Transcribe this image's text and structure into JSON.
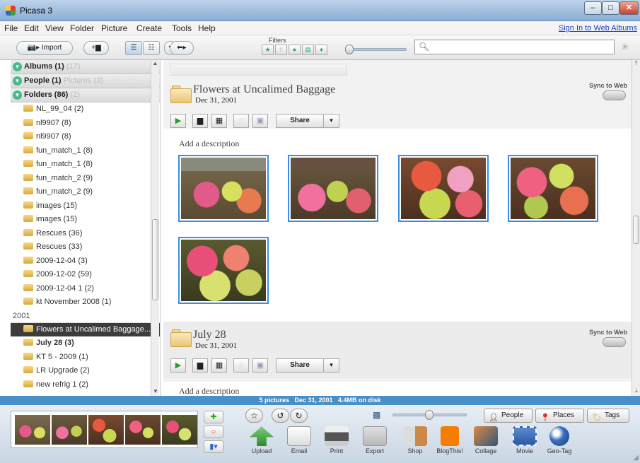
{
  "window": {
    "title": "Picasa 3"
  },
  "menu": [
    "File",
    "Edit",
    "View",
    "Folder",
    "Picture",
    "Create",
    "Tools",
    "Help"
  ],
  "signin": "Sign In to Web Albums",
  "toolbar": {
    "import_label": "Import",
    "filters_label": "Filters"
  },
  "search": {
    "value": "",
    "placeholder": ""
  },
  "leftpanel": {
    "albums": {
      "label": "Albums (1)",
      "ghost": "(17)"
    },
    "people": {
      "label": "People (1)",
      "ghost": "Pictures (3)"
    },
    "folders": {
      "label": "Folders (86)",
      "ghost": "(2)"
    },
    "items_a": [
      "NL_99_04 (2)",
      "nl9907 (8)",
      "nl9907 (8)",
      "fun_match_1 (8)",
      "fun_match_1 (8)",
      "fun_match_2 (9)",
      "fun_match_2 (9)",
      "images (15)",
      "images (15)",
      "Rescues (36)",
      "Rescues (33)",
      "2009-12-04 (3)",
      "2009-12-02 (59)",
      "2009-12-04 1 (2)",
      "kt November 2008 (1)"
    ],
    "year": "2001",
    "selected": "Flowers at Uncalimed Baggage...",
    "items_b": [
      "July 28 (3)",
      "KT 5 - 2009 (1)",
      "LR Upgrade (2)",
      "new refrig 1 (2)"
    ]
  },
  "album1": {
    "title": "Flowers at Uncalimed Baggage",
    "date": "Dec 31, 2001",
    "sync": "Sync to Web",
    "share": "Share",
    "description": "Add a description"
  },
  "album2": {
    "title": "July 28",
    "date": "Dec 31, 2001",
    "sync": "Sync to Web",
    "share": "Share",
    "description": "Add a description"
  },
  "status": {
    "pictures": "5 pictures",
    "date": "Dec 31, 2001",
    "size": "4.4MB on disk"
  },
  "tray": {
    "people": "People",
    "places": "Places",
    "tags": "Tags",
    "actions": [
      "Upload",
      "Email",
      "Print",
      "Export",
      "Shop",
      "BlogThis!",
      "Collage",
      "Movie",
      "Geo-Tag"
    ]
  },
  "colors": {
    "selection": "#3a8ee6",
    "statusbar": "#4a90c8",
    "selected_folder": "#3c3c3c"
  }
}
